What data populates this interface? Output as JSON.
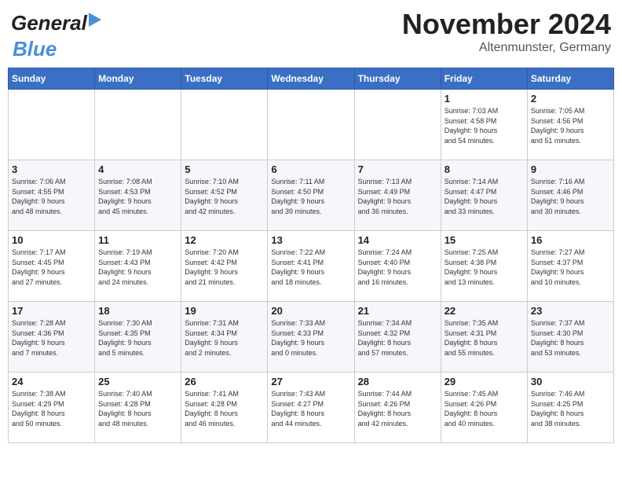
{
  "header": {
    "logo_general": "General",
    "logo_blue": "Blue",
    "month_title": "November 2024",
    "location": "Altenmunster, Germany"
  },
  "days_of_week": [
    "Sunday",
    "Monday",
    "Tuesday",
    "Wednesday",
    "Thursday",
    "Friday",
    "Saturday"
  ],
  "weeks": [
    [
      {
        "day": "",
        "info": ""
      },
      {
        "day": "",
        "info": ""
      },
      {
        "day": "",
        "info": ""
      },
      {
        "day": "",
        "info": ""
      },
      {
        "day": "",
        "info": ""
      },
      {
        "day": "1",
        "info": "Sunrise: 7:03 AM\nSunset: 4:58 PM\nDaylight: 9 hours\nand 54 minutes."
      },
      {
        "day": "2",
        "info": "Sunrise: 7:05 AM\nSunset: 4:56 PM\nDaylight: 9 hours\nand 51 minutes."
      }
    ],
    [
      {
        "day": "3",
        "info": "Sunrise: 7:06 AM\nSunset: 4:55 PM\nDaylight: 9 hours\nand 48 minutes."
      },
      {
        "day": "4",
        "info": "Sunrise: 7:08 AM\nSunset: 4:53 PM\nDaylight: 9 hours\nand 45 minutes."
      },
      {
        "day": "5",
        "info": "Sunrise: 7:10 AM\nSunset: 4:52 PM\nDaylight: 9 hours\nand 42 minutes."
      },
      {
        "day": "6",
        "info": "Sunrise: 7:11 AM\nSunset: 4:50 PM\nDaylight: 9 hours\nand 39 minutes."
      },
      {
        "day": "7",
        "info": "Sunrise: 7:13 AM\nSunset: 4:49 PM\nDaylight: 9 hours\nand 36 minutes."
      },
      {
        "day": "8",
        "info": "Sunrise: 7:14 AM\nSunset: 4:47 PM\nDaylight: 9 hours\nand 33 minutes."
      },
      {
        "day": "9",
        "info": "Sunrise: 7:16 AM\nSunset: 4:46 PM\nDaylight: 9 hours\nand 30 minutes."
      }
    ],
    [
      {
        "day": "10",
        "info": "Sunrise: 7:17 AM\nSunset: 4:45 PM\nDaylight: 9 hours\nand 27 minutes."
      },
      {
        "day": "11",
        "info": "Sunrise: 7:19 AM\nSunset: 4:43 PM\nDaylight: 9 hours\nand 24 minutes."
      },
      {
        "day": "12",
        "info": "Sunrise: 7:20 AM\nSunset: 4:42 PM\nDaylight: 9 hours\nand 21 minutes."
      },
      {
        "day": "13",
        "info": "Sunrise: 7:22 AM\nSunset: 4:41 PM\nDaylight: 9 hours\nand 18 minutes."
      },
      {
        "day": "14",
        "info": "Sunrise: 7:24 AM\nSunset: 4:40 PM\nDaylight: 9 hours\nand 16 minutes."
      },
      {
        "day": "15",
        "info": "Sunrise: 7:25 AM\nSunset: 4:38 PM\nDaylight: 9 hours\nand 13 minutes."
      },
      {
        "day": "16",
        "info": "Sunrise: 7:27 AM\nSunset: 4:37 PM\nDaylight: 9 hours\nand 10 minutes."
      }
    ],
    [
      {
        "day": "17",
        "info": "Sunrise: 7:28 AM\nSunset: 4:36 PM\nDaylight: 9 hours\nand 7 minutes."
      },
      {
        "day": "18",
        "info": "Sunrise: 7:30 AM\nSunset: 4:35 PM\nDaylight: 9 hours\nand 5 minutes."
      },
      {
        "day": "19",
        "info": "Sunrise: 7:31 AM\nSunset: 4:34 PM\nDaylight: 9 hours\nand 2 minutes."
      },
      {
        "day": "20",
        "info": "Sunrise: 7:33 AM\nSunset: 4:33 PM\nDaylight: 9 hours\nand 0 minutes."
      },
      {
        "day": "21",
        "info": "Sunrise: 7:34 AM\nSunset: 4:32 PM\nDaylight: 8 hours\nand 57 minutes."
      },
      {
        "day": "22",
        "info": "Sunrise: 7:35 AM\nSunset: 4:31 PM\nDaylight: 8 hours\nand 55 minutes."
      },
      {
        "day": "23",
        "info": "Sunrise: 7:37 AM\nSunset: 4:30 PM\nDaylight: 8 hours\nand 53 minutes."
      }
    ],
    [
      {
        "day": "24",
        "info": "Sunrise: 7:38 AM\nSunset: 4:29 PM\nDaylight: 8 hours\nand 50 minutes."
      },
      {
        "day": "25",
        "info": "Sunrise: 7:40 AM\nSunset: 4:28 PM\nDaylight: 8 hours\nand 48 minutes."
      },
      {
        "day": "26",
        "info": "Sunrise: 7:41 AM\nSunset: 4:28 PM\nDaylight: 8 hours\nand 46 minutes."
      },
      {
        "day": "27",
        "info": "Sunrise: 7:43 AM\nSunset: 4:27 PM\nDaylight: 8 hours\nand 44 minutes."
      },
      {
        "day": "28",
        "info": "Sunrise: 7:44 AM\nSunset: 4:26 PM\nDaylight: 8 hours\nand 42 minutes."
      },
      {
        "day": "29",
        "info": "Sunrise: 7:45 AM\nSunset: 4:26 PM\nDaylight: 8 hours\nand 40 minutes."
      },
      {
        "day": "30",
        "info": "Sunrise: 7:46 AM\nSunset: 4:25 PM\nDaylight: 8 hours\nand 38 minutes."
      }
    ]
  ]
}
